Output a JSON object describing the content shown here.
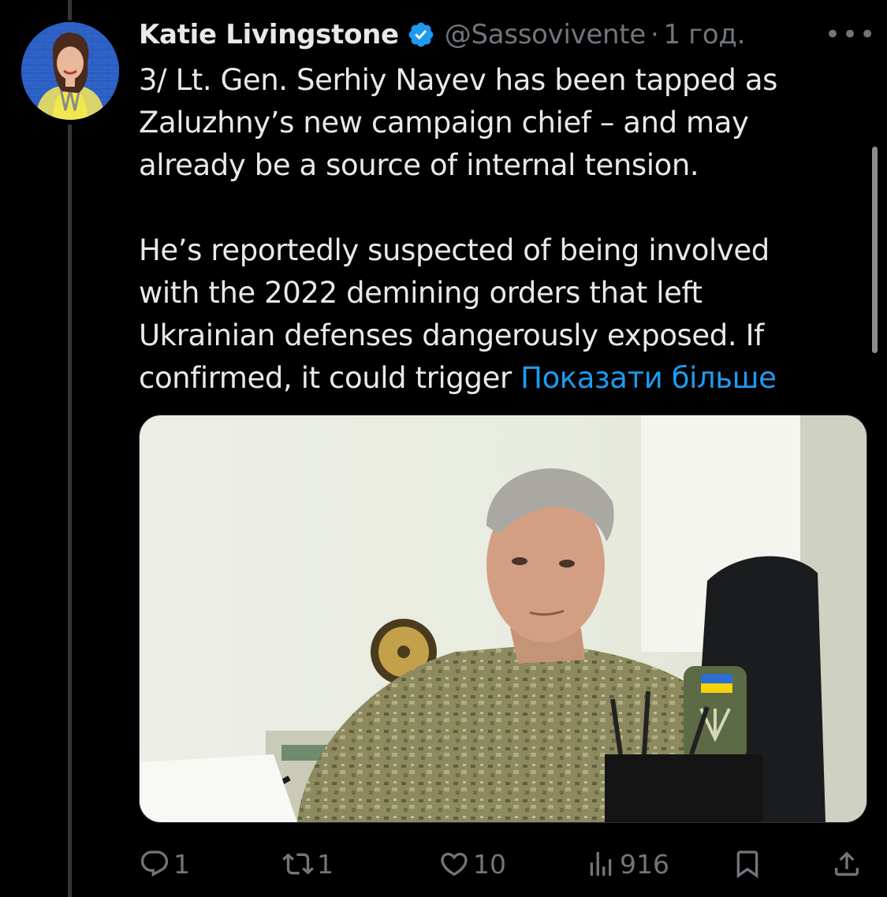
{
  "tweet": {
    "author_name": "Katie Livingstone",
    "handle": "@Sassovivente",
    "separator": "·",
    "time": "1 год.",
    "more": "•••",
    "text": "3/ Lt. Gen. Serhiy Nayev has been tapped as\nZaluzhny’s new campaign chief – and may\nalready be a source of internal tension.\n\nHe’s reportedly suspected of being involved\nwith the 2022 demining orders that left\nUkrainian defenses dangerously exposed. If\nconfirmed, it could trigger ",
    "show_more": "Показати більше"
  },
  "actions": {
    "replies": "1",
    "retweets": "1",
    "likes": "10",
    "views": "916"
  },
  "colors": {
    "background": "#000000",
    "text": "#e7e9ea",
    "muted": "#71767b",
    "accent": "#1d9bf0"
  },
  "icons": [
    "verified-badge-icon",
    "more-icon",
    "reply-icon",
    "retweet-icon",
    "like-icon",
    "views-icon",
    "bookmark-icon",
    "share-icon"
  ]
}
